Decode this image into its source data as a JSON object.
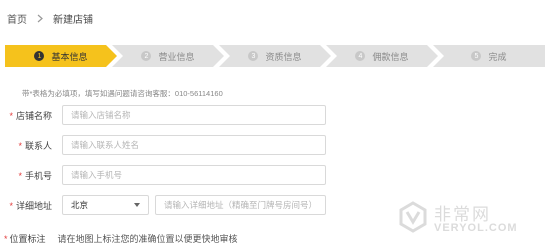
{
  "breadcrumb": {
    "home": "首页",
    "current": "新建店铺"
  },
  "steps": [
    {
      "num": "1",
      "label": "基本信息",
      "active": true
    },
    {
      "num": "2",
      "label": "营业信息",
      "active": false
    },
    {
      "num": "3",
      "label": "资质信息",
      "active": false
    },
    {
      "num": "4",
      "label": "佣款信息",
      "active": false
    },
    {
      "num": "5",
      "label": "完成",
      "active": false
    }
  ],
  "notice": "带*表格为必填项，填写如遇问题请咨询客服：010-56114160",
  "form": {
    "store_name": {
      "required_mark": "*",
      "label": "店铺名称",
      "placeholder": "请输入店铺名称"
    },
    "contact": {
      "required_mark": "*",
      "label": "联系人",
      "placeholder": "请输入联系人姓名"
    },
    "phone": {
      "required_mark": "*",
      "label": "手机号",
      "placeholder": "请输入手机号"
    },
    "address": {
      "required_mark": "*",
      "label": "详细地址",
      "city_value": "北京",
      "placeholder": "请输入详细地址（精确至门牌号房间号）"
    },
    "location": {
      "required_mark": "*",
      "label": "位置标注",
      "hint": "请在地图上标注您的准确位置以便更快地审核"
    }
  },
  "watermark": {
    "text_cn": "非常网",
    "text_en": "VERYOL.COM"
  },
  "colors": {
    "accent": "#f5c21c",
    "step_inactive": "#e1e1e1",
    "required": "#e23b3b"
  }
}
